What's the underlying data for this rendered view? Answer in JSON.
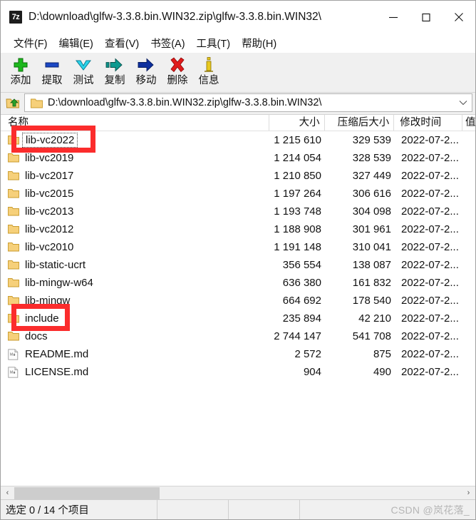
{
  "window": {
    "app_icon_label": "7z",
    "title": "D:\\download\\glfw-3.3.8.bin.WIN32.zip\\glfw-3.3.8.bin.WIN32\\",
    "controls": {
      "minimize": "minimize",
      "maximize": "maximize",
      "close": "close"
    }
  },
  "menubar": {
    "items": [
      {
        "label": "文件(F)",
        "name": "menu-file"
      },
      {
        "label": "编辑(E)",
        "name": "menu-edit"
      },
      {
        "label": "查看(V)",
        "name": "menu-view"
      },
      {
        "label": "书签(A)",
        "name": "menu-bookmarks"
      },
      {
        "label": "工具(T)",
        "name": "menu-tools"
      },
      {
        "label": "帮助(H)",
        "name": "menu-help"
      }
    ]
  },
  "toolbar": {
    "buttons": [
      {
        "label": "添加",
        "icon": "plus-icon",
        "color": "#19a319"
      },
      {
        "label": "提取",
        "icon": "minus-icon",
        "color": "#1b47c4"
      },
      {
        "label": "测试",
        "icon": "check-down-icon",
        "color": "#22c8e0"
      },
      {
        "label": "复制",
        "icon": "copy-arrow-icon",
        "color": "#0e8f86"
      },
      {
        "label": "移动",
        "icon": "move-arrow-icon",
        "color": "#0d2f9e"
      },
      {
        "label": "删除",
        "icon": "delete-x-icon",
        "color": "#e01b1b"
      },
      {
        "label": "信息",
        "icon": "info-i-icon",
        "color": "#e8c81e"
      }
    ]
  },
  "addressbar": {
    "up_button_icon": "folder-up-icon",
    "folder_icon": "folder-icon",
    "path": "D:\\download\\glfw-3.3.8.bin.WIN32.zip\\glfw-3.3.8.bin.WIN32\\",
    "dropdown_icon": "chevron-down-icon"
  },
  "filelist": {
    "columns": [
      {
        "label": "名称",
        "name": "column-name"
      },
      {
        "label": "大小",
        "name": "column-size"
      },
      {
        "label": "压缩后大小",
        "name": "column-packed-size"
      },
      {
        "label": "修改时间",
        "name": "column-modified"
      },
      {
        "label": "值",
        "name": "column-attributes"
      }
    ],
    "rows": [
      {
        "name": "lib-vc2022",
        "icon": "folder-icon",
        "size": "1 215 610",
        "packed": "329 539",
        "modified": "2022-07-2...",
        "focused": true,
        "annotated": true
      },
      {
        "name": "lib-vc2019",
        "icon": "folder-icon",
        "size": "1 214 054",
        "packed": "328 539",
        "modified": "2022-07-2...",
        "focused": false,
        "annotated": false
      },
      {
        "name": "lib-vc2017",
        "icon": "folder-icon",
        "size": "1 210 850",
        "packed": "327 449",
        "modified": "2022-07-2...",
        "focused": false,
        "annotated": false
      },
      {
        "name": "lib-vc2015",
        "icon": "folder-icon",
        "size": "1 197 264",
        "packed": "306 616",
        "modified": "2022-07-2...",
        "focused": false,
        "annotated": false
      },
      {
        "name": "lib-vc2013",
        "icon": "folder-icon",
        "size": "1 193 748",
        "packed": "304 098",
        "modified": "2022-07-2...",
        "focused": false,
        "annotated": false
      },
      {
        "name": "lib-vc2012",
        "icon": "folder-icon",
        "size": "1 188 908",
        "packed": "301 961",
        "modified": "2022-07-2...",
        "focused": false,
        "annotated": false
      },
      {
        "name": "lib-vc2010",
        "icon": "folder-icon",
        "size": "1 191 148",
        "packed": "310 041",
        "modified": "2022-07-2...",
        "focused": false,
        "annotated": false
      },
      {
        "name": "lib-static-ucrt",
        "icon": "folder-icon",
        "size": "356 554",
        "packed": "138 087",
        "modified": "2022-07-2...",
        "focused": false,
        "annotated": false
      },
      {
        "name": "lib-mingw-w64",
        "icon": "folder-icon",
        "size": "636 380",
        "packed": "161 832",
        "modified": "2022-07-2...",
        "focused": false,
        "annotated": false
      },
      {
        "name": "lib-mingw",
        "icon": "folder-icon",
        "size": "664 692",
        "packed": "178 540",
        "modified": "2022-07-2...",
        "focused": false,
        "annotated": false
      },
      {
        "name": "include",
        "icon": "folder-icon",
        "size": "235 894",
        "packed": "42 210",
        "modified": "2022-07-2...",
        "focused": false,
        "annotated": true
      },
      {
        "name": "docs",
        "icon": "folder-icon",
        "size": "2 744 147",
        "packed": "541 708",
        "modified": "2022-07-2...",
        "focused": false,
        "annotated": false
      },
      {
        "name": "README.md",
        "icon": "markdown-file-icon",
        "size": "2 572",
        "packed": "875",
        "modified": "2022-07-2...",
        "focused": false,
        "annotated": false
      },
      {
        "name": "LICENSE.md",
        "icon": "markdown-file-icon",
        "size": "904",
        "packed": "490",
        "modified": "2022-07-2...",
        "focused": false,
        "annotated": false
      }
    ]
  },
  "scrollbar": {
    "left_arrow": "‹",
    "right_arrow": "›"
  },
  "statusbar": {
    "selection": "选定 0 / 14 个项目",
    "cell2": "",
    "cell3": "",
    "watermark": "CSDN @岚花落_"
  },
  "colors": {
    "annotation_red": "#fb2c2c",
    "folder_yellow": "#f6d07a",
    "toolbar_bg": "#f0f0f0"
  }
}
